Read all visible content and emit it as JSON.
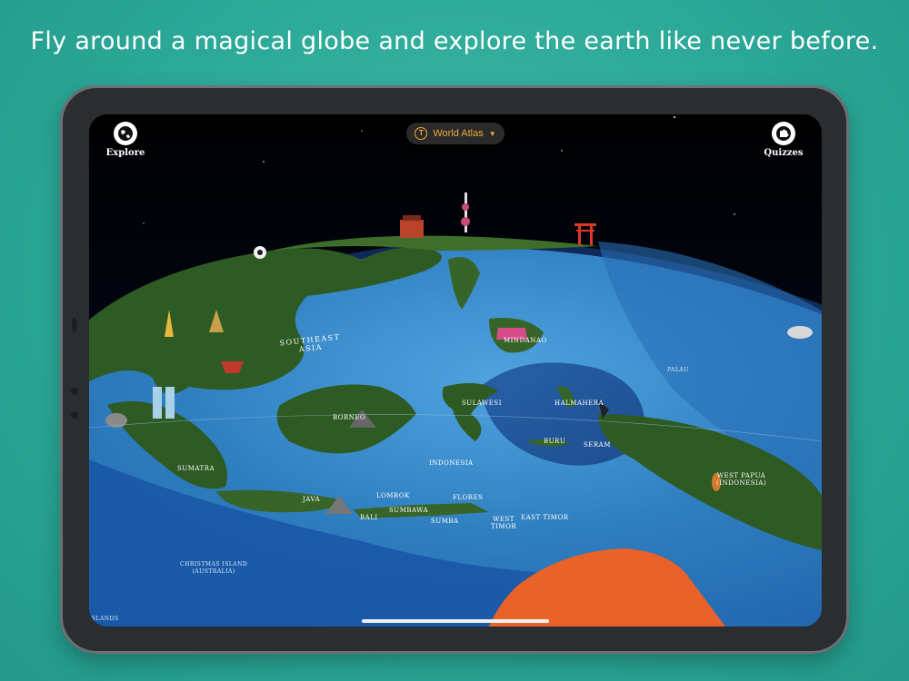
{
  "headline": "Fly around a magical globe and explore the earth like never before.",
  "toolbar": {
    "explore_label": "Explore",
    "atlas_label": "World Atlas",
    "quizzes_label": "Quizzes"
  },
  "map_labels": {
    "region": "SOUTHEAST\nASIA",
    "borneo": "BORNEO",
    "sumatra": "SUMATRA",
    "java": "JAVA",
    "bali": "BALI",
    "lombok": "LOMBOK",
    "sumbawa": "SUMBAWA",
    "flores": "FLORES",
    "sumba": "SUMBA",
    "west_timor": "WEST\nTIMOR",
    "east_timor": "EAST TIMOR",
    "sulawesi": "SULAWESI",
    "indonesia": "INDONESIA",
    "mindanao": "MINDANAO",
    "buru": "BURU",
    "seram": "SERAM",
    "halmahera": "HALMAHERA",
    "palau": "PALAU",
    "west_papua": "WEST PAPUA\n(INDONESIA)",
    "christmas_island": "CHRISTMAS ISLAND\n(AUSTRALIA)",
    "islands": "ISLANDS"
  },
  "colors": {
    "background": "#2aa796",
    "atlas_accent": "#f2a93b",
    "ocean": "#2f7fc0",
    "land": "#2e5a23",
    "australia": "#e8622a"
  },
  "icons": {
    "explore": "globe-icon",
    "atlas": "filter-icon",
    "dropdown": "caret-down-icon",
    "quizzes": "puzzle-icon"
  }
}
